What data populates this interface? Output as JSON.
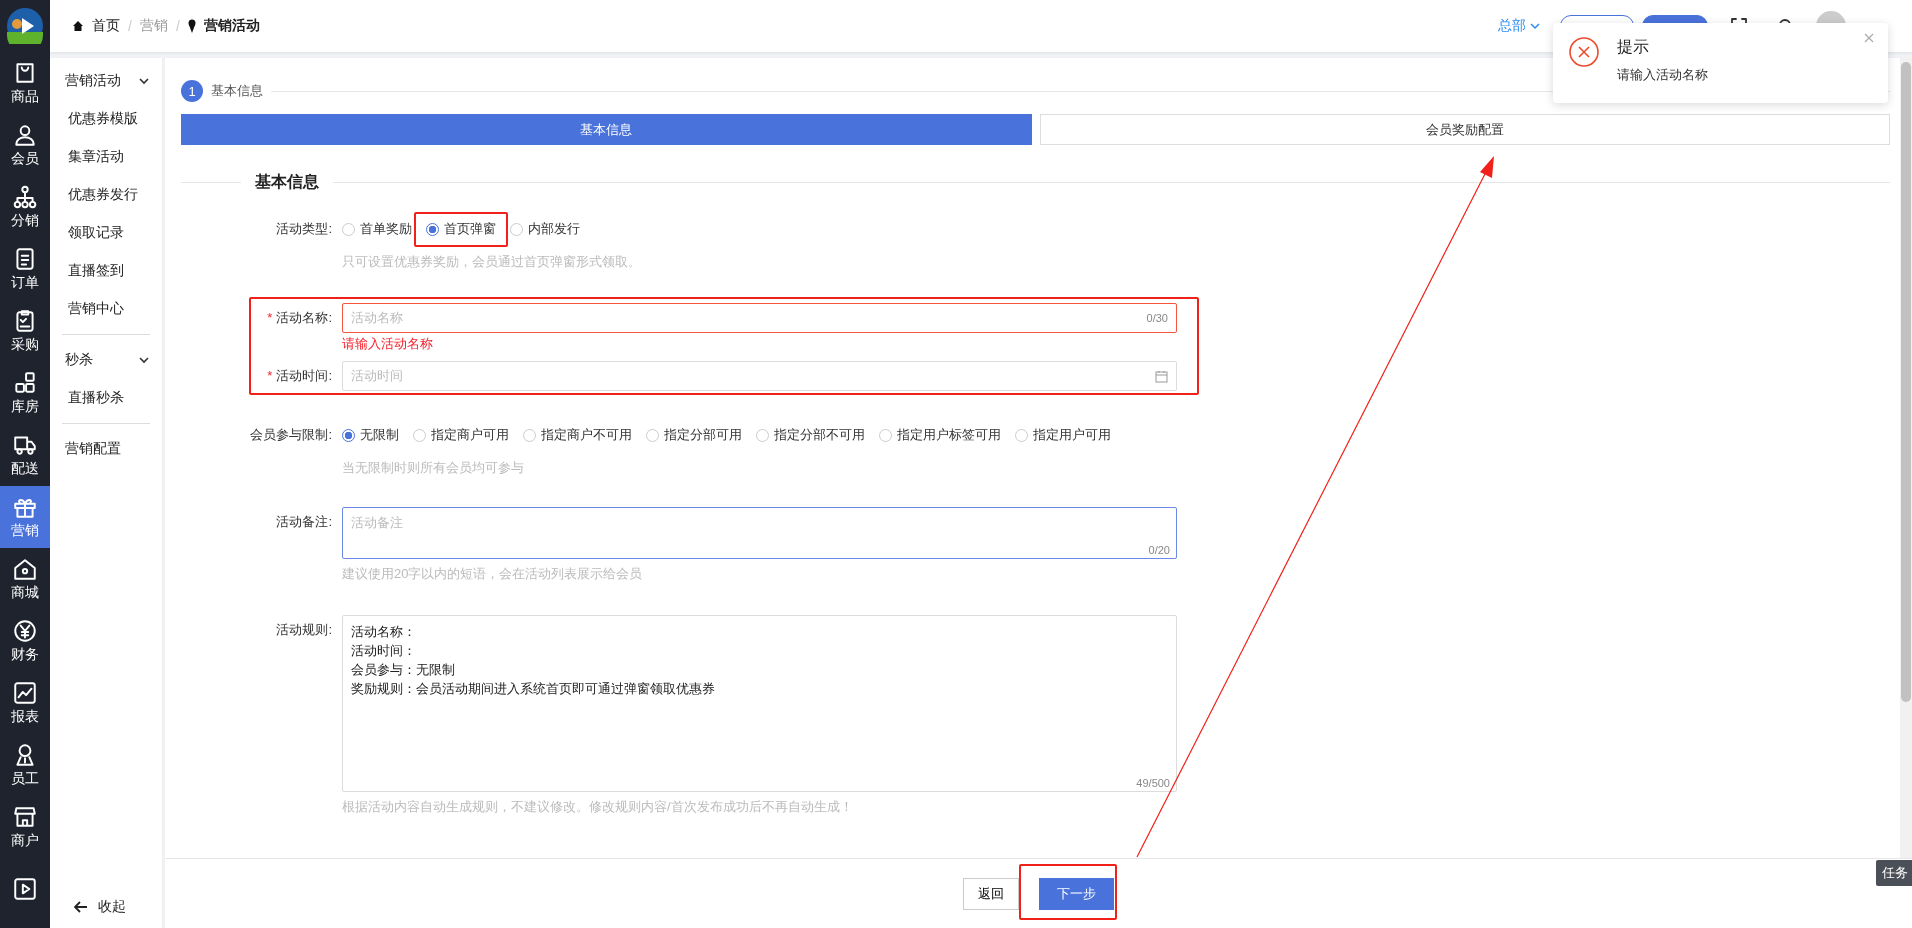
{
  "breadcrumb": [
    {
      "label": "首页",
      "kind": "home"
    },
    {
      "separator_before": "/",
      "label": "营销",
      "kind": "link"
    },
    {
      "separator_before": "/",
      "label": "营销活动",
      "kind": "current"
    }
  ],
  "header": {
    "org": "总部",
    "buttons": [
      {
        "kind": "outline"
      },
      {
        "kind": "filled"
      }
    ]
  },
  "nav": [
    {
      "label": "商品",
      "selected": false
    },
    {
      "label": "会员",
      "selected": false
    },
    {
      "label": "分销",
      "selected": false
    },
    {
      "label": "订单",
      "selected": false
    },
    {
      "label": "采购",
      "selected": false
    },
    {
      "label": "库房",
      "selected": false
    },
    {
      "label": "配送",
      "selected": false
    },
    {
      "label": "营销",
      "selected": true
    },
    {
      "label": "商城",
      "selected": false
    },
    {
      "label": "财务",
      "selected": false
    },
    {
      "label": "报表",
      "selected": false
    },
    {
      "label": "员工",
      "selected": false
    },
    {
      "label": "商户",
      "selected": false
    },
    {
      "selected": false
    }
  ],
  "submenu": {
    "groups": [
      {
        "label": "营销活动",
        "expanded": true,
        "children": [
          "优惠券模版",
          "集章活动",
          "优惠券发行",
          "领取记录",
          "直播签到",
          "营销中心"
        ]
      },
      {
        "label": "秒杀",
        "expanded": true,
        "children": [
          "直播秒杀"
        ]
      },
      {
        "label": "营销配置"
      }
    ],
    "collapse": "收起"
  },
  "steps": {
    "number": "1",
    "label": "基本信息"
  },
  "tabs": [
    {
      "label": "基本信息",
      "selected": true
    },
    {
      "label": "会员奖励配置",
      "selected": false
    }
  ],
  "section_title": "基本信息",
  "form": {
    "activity_type": {
      "label": "活动类型:",
      "options": [
        {
          "label": "首单奖励",
          "selected": false
        },
        {
          "label": "首页弹窗",
          "selected": true
        },
        {
          "label": "内部发行",
          "selected": false
        }
      ],
      "hint": "只可设置优惠券奖励，会员通过首页弹窗形式领取。"
    },
    "name": {
      "required_mark": "*",
      "label": "活动名称:",
      "placeholder": "活动名称",
      "counter": "0/30",
      "error": "请输入活动名称"
    },
    "time": {
      "required_mark": "*",
      "label": "活动时间:",
      "placeholder": "活动时间"
    },
    "member_limit": {
      "label": "会员参与限制:",
      "options": [
        {
          "label": "无限制",
          "selected": true
        },
        {
          "label": "指定商户可用",
          "selected": false
        },
        {
          "label": "指定商户不可用",
          "selected": false
        },
        {
          "label": "指定分部可用",
          "selected": false
        },
        {
          "label": "指定分部不可用",
          "selected": false
        },
        {
          "label": "指定用户标签可用",
          "selected": false
        },
        {
          "label": "指定用户可用",
          "selected": false
        }
      ],
      "hint": "当无限制时则所有会员均可参与"
    },
    "note": {
      "label": "活动备注:",
      "placeholder": "活动备注",
      "counter": "0/20",
      "focused": true,
      "hint": "建议使用20字以内的短语，会在活动列表展示给会员"
    },
    "rules": {
      "label": "活动规则:",
      "lines": [
        "活动名称：",
        "活动时间：",
        "会员参与：无限制",
        "奖励规则：会员活动期间进入系统首页即可通过弹窗领取优惠券"
      ],
      "counter": "49/500",
      "hint": "根据活动内容自动生成规则，不建议修改。修改规则内容/首次发布成功后不再自动生成！"
    }
  },
  "footer": {
    "back": "返回",
    "next": "下一步"
  },
  "toast": {
    "title": "提示",
    "message": "请输入活动名称"
  },
  "task_tab": "任务"
}
